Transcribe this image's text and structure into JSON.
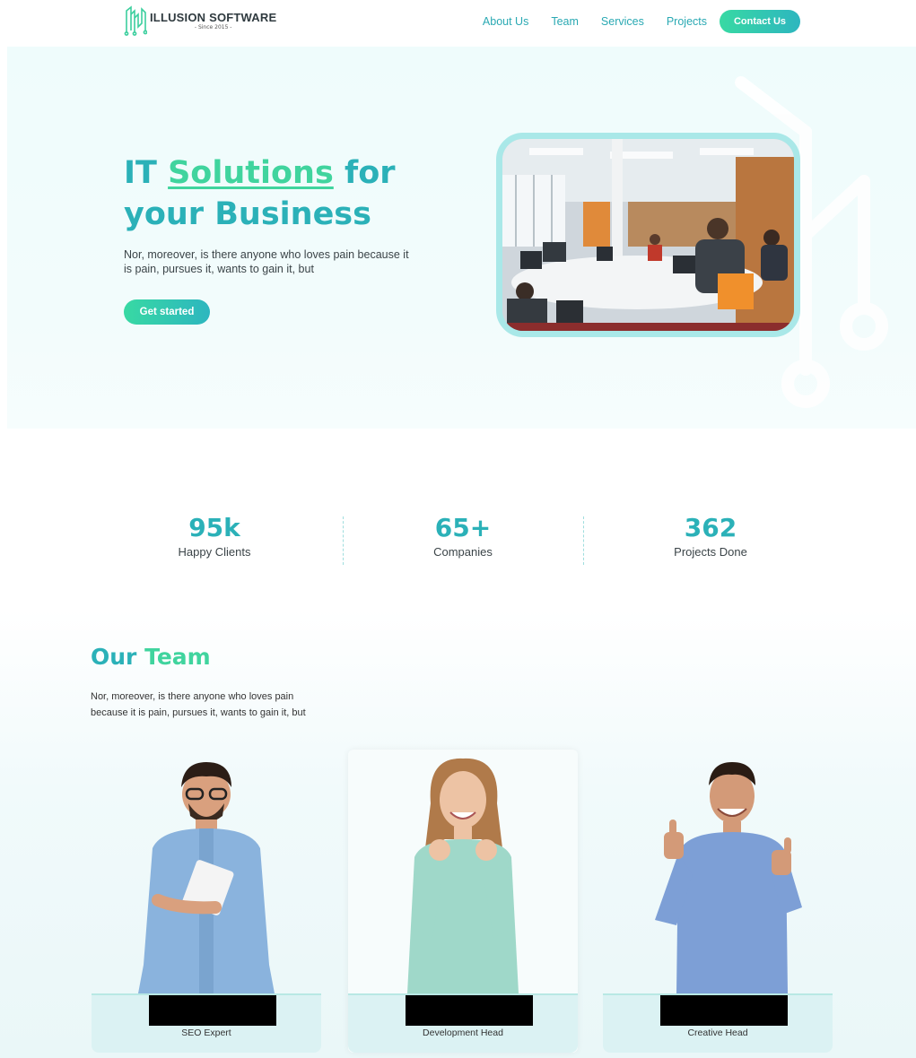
{
  "header": {
    "logo_name": "ILLUSION SOFTWARE",
    "logo_since": "- Since 2015 -",
    "nav": [
      "About Us",
      "Team",
      "Services",
      "Projects"
    ],
    "contact_label": "Contact Us"
  },
  "hero": {
    "title_part1": "IT ",
    "title_accent": "Solutions",
    "title_part2": " for",
    "title_line2": "your Business",
    "description": "Nor, moreover, is there anyone who loves pain because it is pain, pursues it, wants to gain it, but",
    "cta_label": "Get started"
  },
  "stats": [
    {
      "value": "95k",
      "label": "Happy Clients"
    },
    {
      "value": "65+",
      "label": "Companies"
    },
    {
      "value": "362",
      "label": "Projects Done"
    }
  ],
  "team": {
    "title_part1": "Our ",
    "title_accent": "Team",
    "description": "Nor, moreover, is there anyone who loves pain because it is pain, pursues it, wants to gain it, but",
    "members": [
      {
        "role": "SEO Expert"
      },
      {
        "role": "Development Head"
      },
      {
        "role": "Creative Head"
      }
    ]
  },
  "colors": {
    "primary": "#2bb1b8",
    "accent": "#40d49e",
    "hero_bg": "#effcfc",
    "card_base": "#dbf2f3"
  },
  "icons": [
    "logo-icon",
    "circuit-decoration"
  ]
}
